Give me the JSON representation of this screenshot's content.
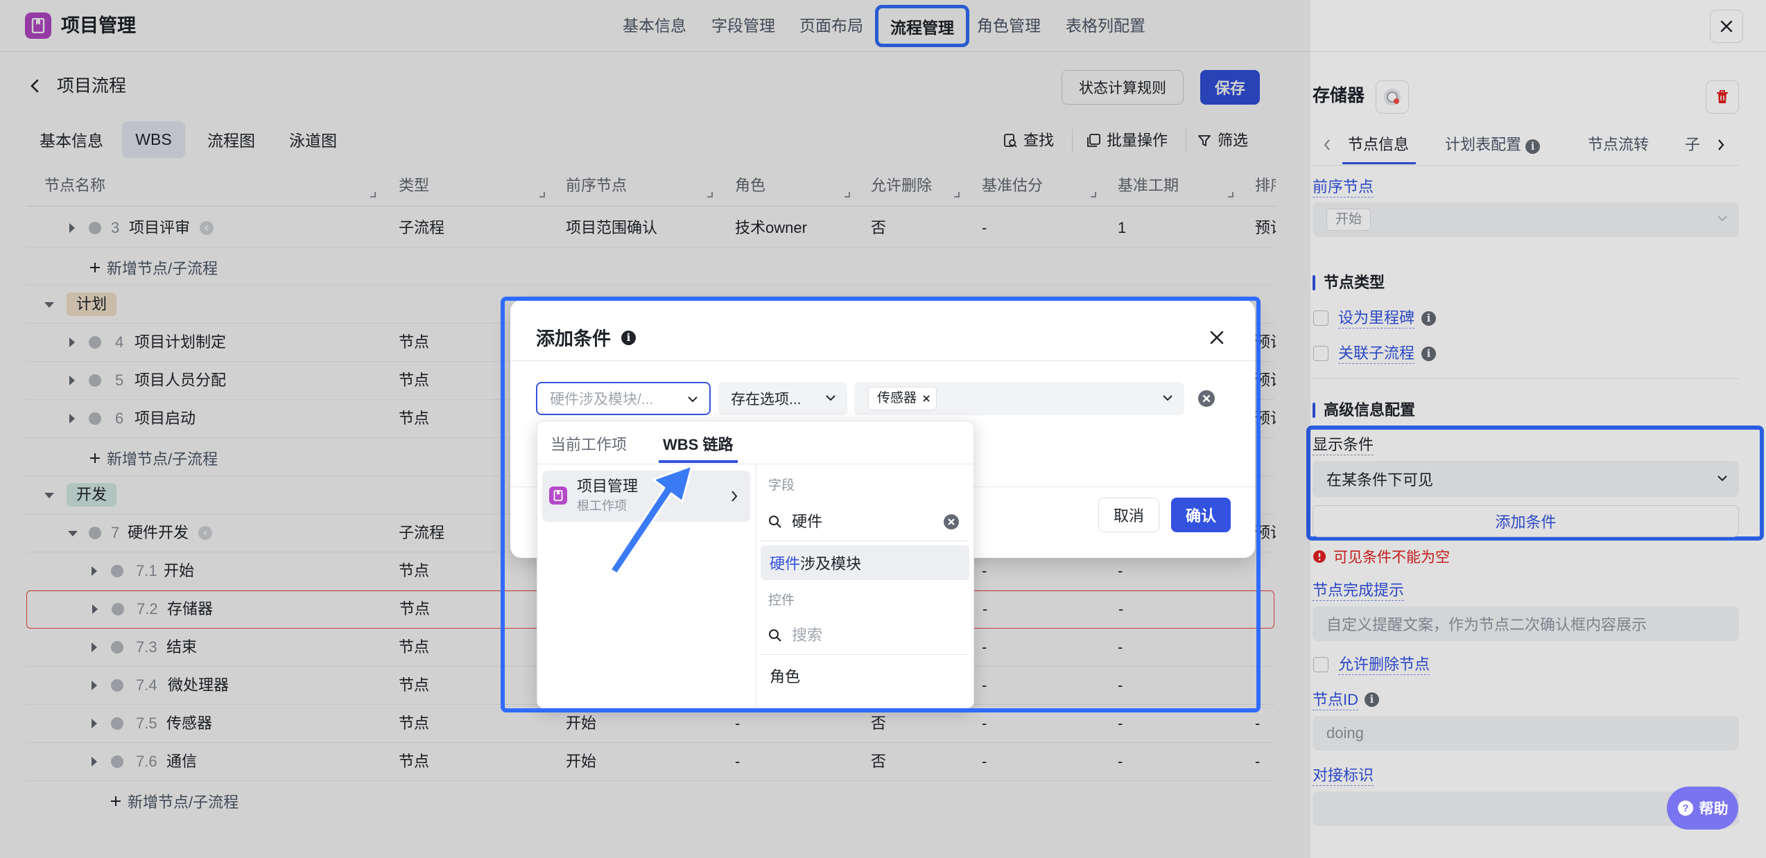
{
  "app": {
    "title": "项目管理"
  },
  "top_tabs": {
    "basic": "基本信息",
    "fields": "字段管理",
    "layout": "页面布局",
    "flow": "流程管理",
    "roles": "角色管理",
    "table": "表格列配置"
  },
  "page": {
    "title": "项目流程",
    "calc_rules_label": "状态计算规则",
    "save_label": "保存"
  },
  "sub_tabs": {
    "basic": "基本信息",
    "wbs": "WBS",
    "flowchart": "流程图",
    "swimlane": "泳道图"
  },
  "toolbar": {
    "find": "查找",
    "batch": "批量操作",
    "filter": "筛选"
  },
  "columns": {
    "name": "节点名称",
    "type": "类型",
    "pre": "前序节点",
    "role": "角色",
    "allow_delete": "允许删除",
    "base_score": "基准估分",
    "base_period": "基准工期",
    "sort": "排序"
  },
  "rows": [
    {
      "num": "3",
      "name": "项目评审",
      "type": "子流程",
      "pre": "项目范围确认",
      "role": "技术owner",
      "del": "否",
      "score": "-",
      "period": "1",
      "sort": "预计"
    },
    {
      "add": "新增节点/子流程"
    },
    {
      "group": "计划"
    },
    {
      "num": "4",
      "name": "项目计划制定",
      "type": "节点",
      "sort": "预计"
    },
    {
      "num": "5",
      "name": "项目人员分配",
      "type": "节点",
      "sort": "预计"
    },
    {
      "num": "6",
      "name": "项目启动",
      "type": "节点",
      "sort": "预计"
    },
    {
      "add": "新增节点/子流程"
    },
    {
      "group": "开发"
    },
    {
      "num": "7",
      "name": "硬件开发",
      "type": "子流程",
      "sort": "预计"
    },
    {
      "num": "7.1",
      "name": "开始",
      "type": "节点",
      "score": "-",
      "period": "-"
    },
    {
      "num": "7.2",
      "name": "存储器",
      "type": "节点",
      "score": "-",
      "period": "-"
    },
    {
      "num": "7.3",
      "name": "结束",
      "type": "节点",
      "score": "-",
      "period": "-"
    },
    {
      "num": "7.4",
      "name": "微处理器",
      "type": "节点",
      "score": "-",
      "period": "-"
    },
    {
      "num": "7.5",
      "name": "传感器",
      "type": "节点",
      "pre": "开始",
      "role": "-",
      "del": "否",
      "score": "-",
      "period": "-",
      "sort": "-"
    },
    {
      "num": "7.6",
      "name": "通信",
      "type": "节点",
      "pre": "开始",
      "role": "-",
      "del": "否",
      "score": "-",
      "period": "-",
      "sort": "-"
    },
    {
      "add": "新增节点/子流程"
    }
  ],
  "panel": {
    "title": "存储器",
    "tabs": {
      "node_info": "节点信息",
      "plan": "计划表配置",
      "flow": "节点流转",
      "sub": "子"
    },
    "pre_node_label": "前序节点",
    "pre_node_value": "开始",
    "node_type_label": "节点类型",
    "milestone_label": "设为里程碑",
    "link_sub_label": "关联子流程",
    "advanced_label": "高级信息配置",
    "display_cond_label": "显示条件",
    "display_cond_value": "在某条件下可见",
    "add_cond_label": "添加条件",
    "error_text": "可见条件不能为空",
    "complete_tip_label": "节点完成提示",
    "complete_tip_placeholder": "自定义提醒文案，作为节点二次确认框内容展示",
    "allow_delete_label": "允许删除节点",
    "node_id_label": "节点ID",
    "node_id_value": "doing",
    "docking_label": "对接标识"
  },
  "modal": {
    "title": "添加条件",
    "field_placeholder": "硬件涉及模块/...",
    "operator": "存在选项...",
    "value_tag": "传感器",
    "cancel": "取消",
    "confirm": "确认"
  },
  "dropdown": {
    "tab_current": "当前工作项",
    "tab_wbs": "WBS 链路",
    "item_title": "项目管理",
    "item_sub": "根工作项",
    "field_header": "字段",
    "search_value": "硬件",
    "result_match": "硬件",
    "result_rest": "涉及模块",
    "control_header": "控件",
    "control_placeholder": "搜索",
    "role_item": "角色"
  },
  "help": {
    "label": "帮助"
  },
  "colors": {
    "primary": "#3352e0",
    "highlight": "#2f6bff",
    "error": "#f54a45",
    "app_icon": "#b549c9"
  }
}
